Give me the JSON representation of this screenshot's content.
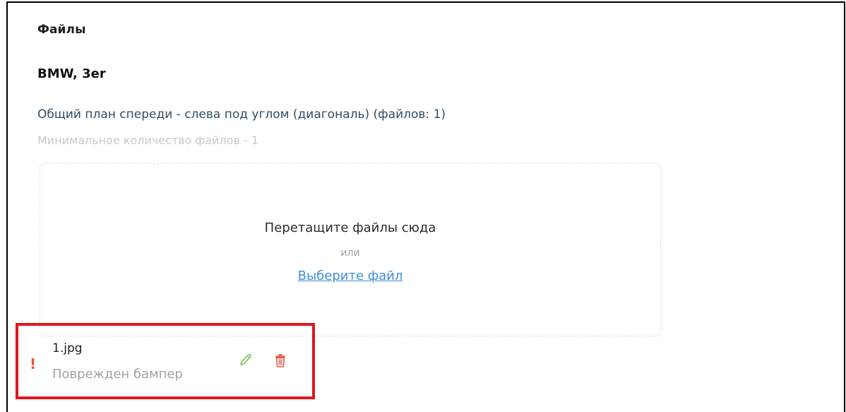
{
  "section": {
    "title": "Файлы"
  },
  "car": {
    "title": "BMW, 3er"
  },
  "photo_slot": {
    "caption": "Общий план спереди - слева под углом (диагональ) (файлов: 1)",
    "min_files_text": "Минимальное количество файлов - 1"
  },
  "dropzone": {
    "hint": "Перетащите файлы сюда",
    "or_text": "или",
    "choose_file_label": "Выберите файл"
  },
  "files": [
    {
      "warning_mark": "!",
      "name": "1.jpg",
      "comment": "Поврежден бампер",
      "edit_icon": "pencil-icon",
      "delete_icon": "trash-icon"
    }
  ],
  "colors": {
    "link": "#3b8fd8",
    "caption": "#2f4d63",
    "warning": "#e4573a",
    "edit": "#7bc35c",
    "delete": "#e45b4f",
    "highlight_border": "#e0161f"
  }
}
